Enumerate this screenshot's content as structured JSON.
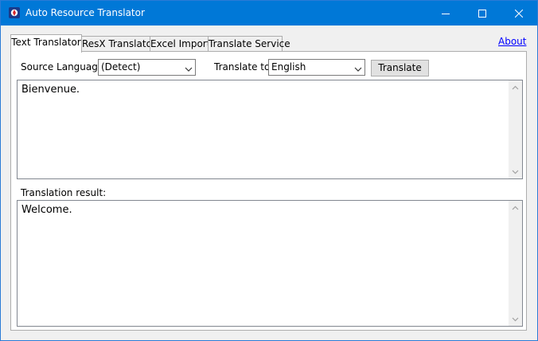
{
  "window": {
    "title": "Auto Resource Translator",
    "icon": "app-icon",
    "controls": [
      "minimize-icon",
      "maximize-icon",
      "close-icon"
    ]
  },
  "tabs": [
    {
      "label": "Text Translator",
      "active": true
    },
    {
      "label": "ResX Translator",
      "active": false
    },
    {
      "label": "Excel Import",
      "active": false
    },
    {
      "label": "Translate Service",
      "active": false
    }
  ],
  "about_link": "About",
  "form": {
    "source_label": "Source Language:",
    "source_value": "(Detect)",
    "target_label": "Translate to:",
    "target_value": "English",
    "translate_button": "Translate"
  },
  "input_text": "Bienvenue.",
  "result_label": "Translation result:",
  "result_text": "Welcome.",
  "colors": {
    "titlebar": "#0078d7",
    "link": "#0000ff"
  }
}
